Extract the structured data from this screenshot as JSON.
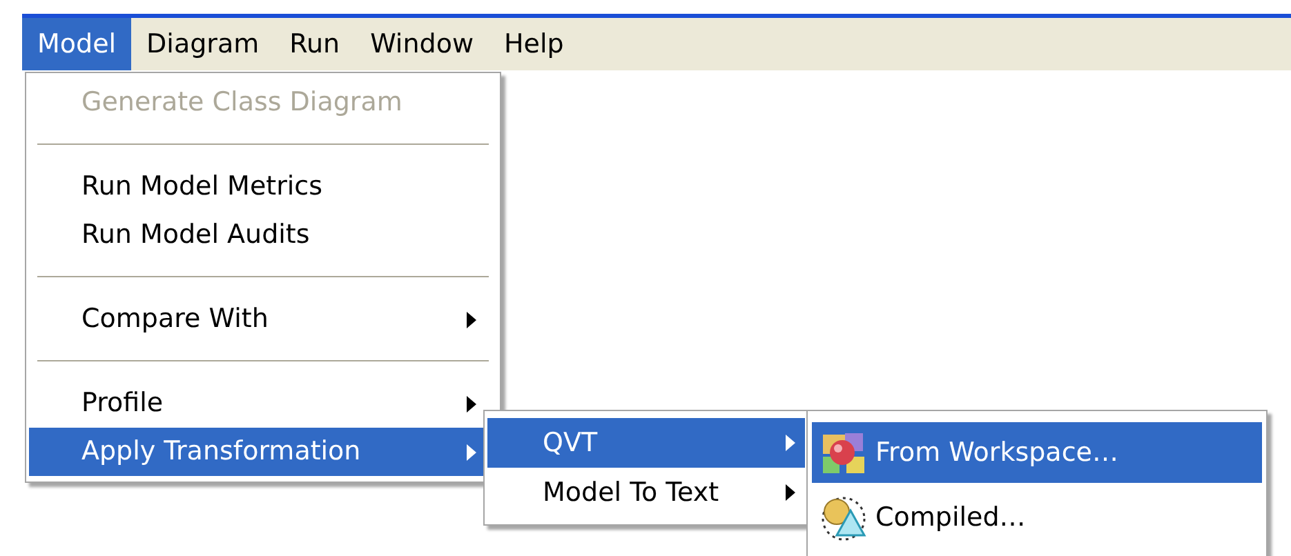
{
  "menubar": [
    {
      "label": "Model",
      "selected": true
    },
    {
      "label": "Diagram",
      "selected": false
    },
    {
      "label": "Run",
      "selected": false
    },
    {
      "label": "Window",
      "selected": false
    },
    {
      "label": "Help",
      "selected": false
    }
  ],
  "model_menu": [
    {
      "kind": "item",
      "label": "Generate Class Diagram",
      "disabled": true,
      "selected": false,
      "submenu": false
    },
    {
      "kind": "separator"
    },
    {
      "kind": "item",
      "label": "Run Model Metrics",
      "disabled": false,
      "selected": false,
      "submenu": false
    },
    {
      "kind": "item",
      "label": "Run Model Audits",
      "disabled": false,
      "selected": false,
      "submenu": false
    },
    {
      "kind": "separator"
    },
    {
      "kind": "item",
      "label": "Compare With",
      "disabled": false,
      "selected": false,
      "submenu": true
    },
    {
      "kind": "separator"
    },
    {
      "kind": "item",
      "label": "Profile",
      "disabled": false,
      "selected": false,
      "submenu": true
    },
    {
      "kind": "item",
      "label": "Apply Transformation",
      "disabled": false,
      "selected": true,
      "submenu": true
    }
  ],
  "transformation_menu": [
    {
      "label": "QVT",
      "selected": true,
      "submenu": true
    },
    {
      "label": "Model To Text",
      "selected": false,
      "submenu": true
    }
  ],
  "qvt_menu": [
    {
      "label": "From Workspace…",
      "selected": true
    },
    {
      "label": "Compiled…",
      "selected": false
    }
  ]
}
